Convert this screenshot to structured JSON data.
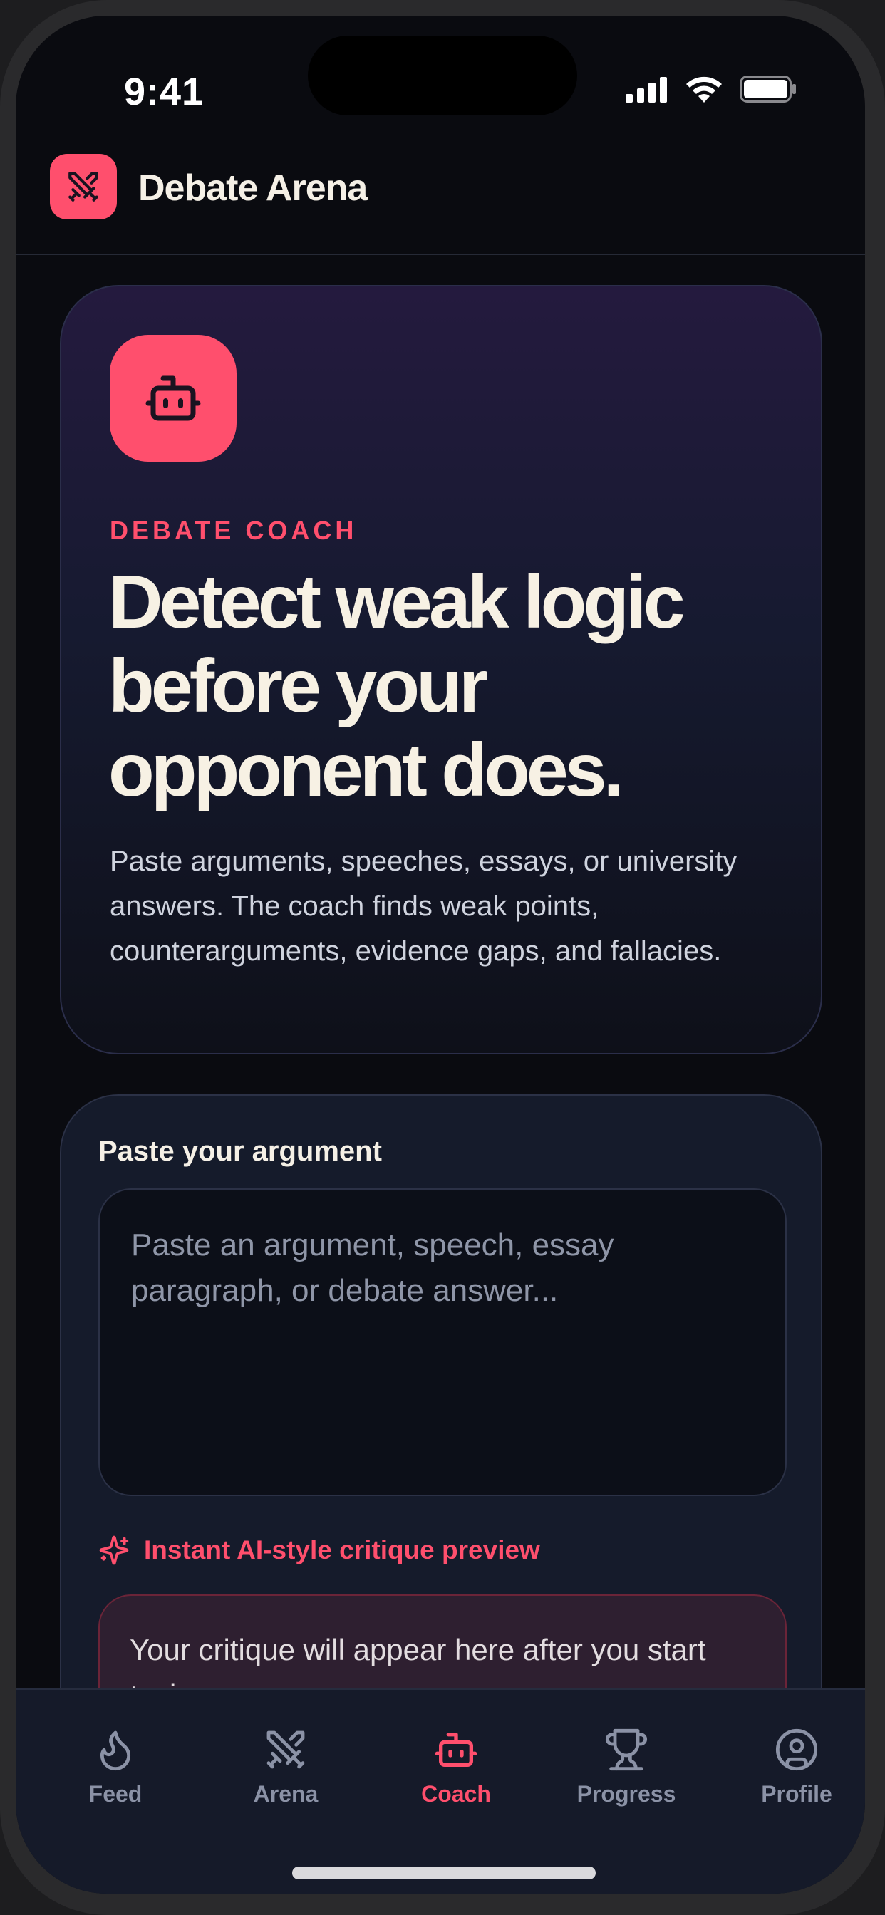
{
  "status": {
    "time": "9:41"
  },
  "app": {
    "title": "Debate Arena"
  },
  "hero": {
    "eyebrow": "DEBATE COACH",
    "headline": "Detect weak logic before your opponent does.",
    "body": "Paste arguments, speeches, essays, or university answers. The coach finds weak points, counterarguments, evidence gaps, and fallacies."
  },
  "input": {
    "label": "Paste your argument",
    "placeholder": "Paste an argument, speech, essay paragraph, or debate answer...",
    "value": ""
  },
  "preview": {
    "label": "Instant AI-style critique preview",
    "text": "Your critique will appear here after you start typing."
  },
  "tabs": [
    {
      "label": "Feed",
      "icon": "flame-icon"
    },
    {
      "label": "Arena",
      "icon": "crossed-swords-icon"
    },
    {
      "label": "Coach",
      "icon": "robot-icon"
    },
    {
      "label": "Progress",
      "icon": "trophy-icon"
    },
    {
      "label": "Profile",
      "icon": "user-circle-icon"
    }
  ],
  "active_tab": "Coach",
  "colors": {
    "accent": "#ff4f6d",
    "background": "#0a0b10",
    "card": "#151b2b",
    "muted": "#8b92a6"
  }
}
